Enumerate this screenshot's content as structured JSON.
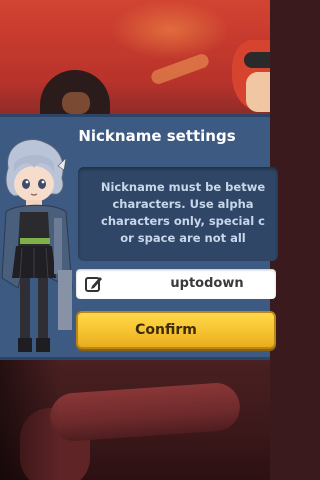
{
  "dialog": {
    "title": "Nickname settings",
    "message": "Nickname must be betwe\ncharacters. Use alpha\ncharacters only, special c\nor space are not all",
    "nickname_value": "uptodown",
    "confirm_label": "Confirm"
  },
  "icons": {
    "edit": "edit-pencil-icon"
  },
  "colors": {
    "dialog_bg": "#3d5a82",
    "message_bg": "#2f4666",
    "confirm_bg": "#f6c230"
  }
}
